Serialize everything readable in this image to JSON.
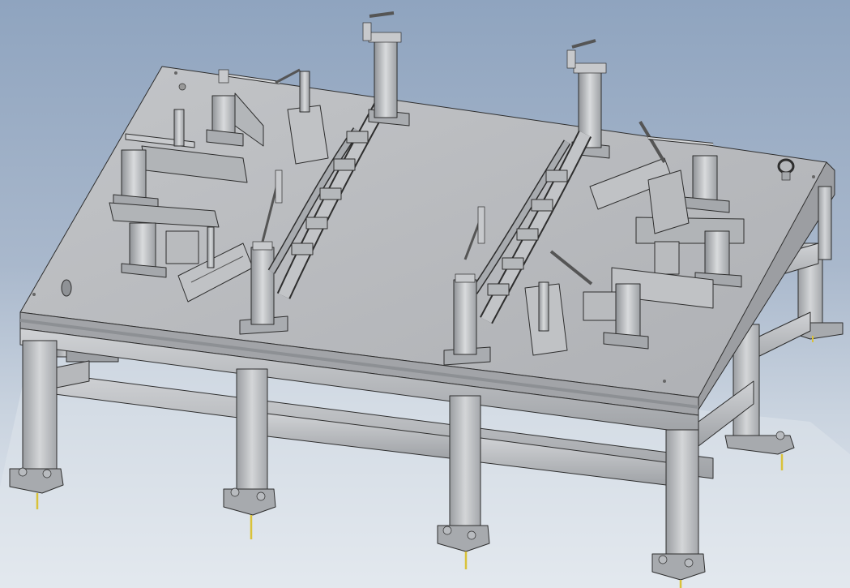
{
  "scene": {
    "subject": "welding-fixture-table",
    "colors": {
      "background_top": "#8fa4bf",
      "background_bottom": "#e6ebf1",
      "table_top": "#b9bbbe",
      "table_edge": "#9c9ea2",
      "frame": "#c4c6c9",
      "frame_shadow": "#8d9094",
      "bolt": "#d9c23a"
    }
  }
}
